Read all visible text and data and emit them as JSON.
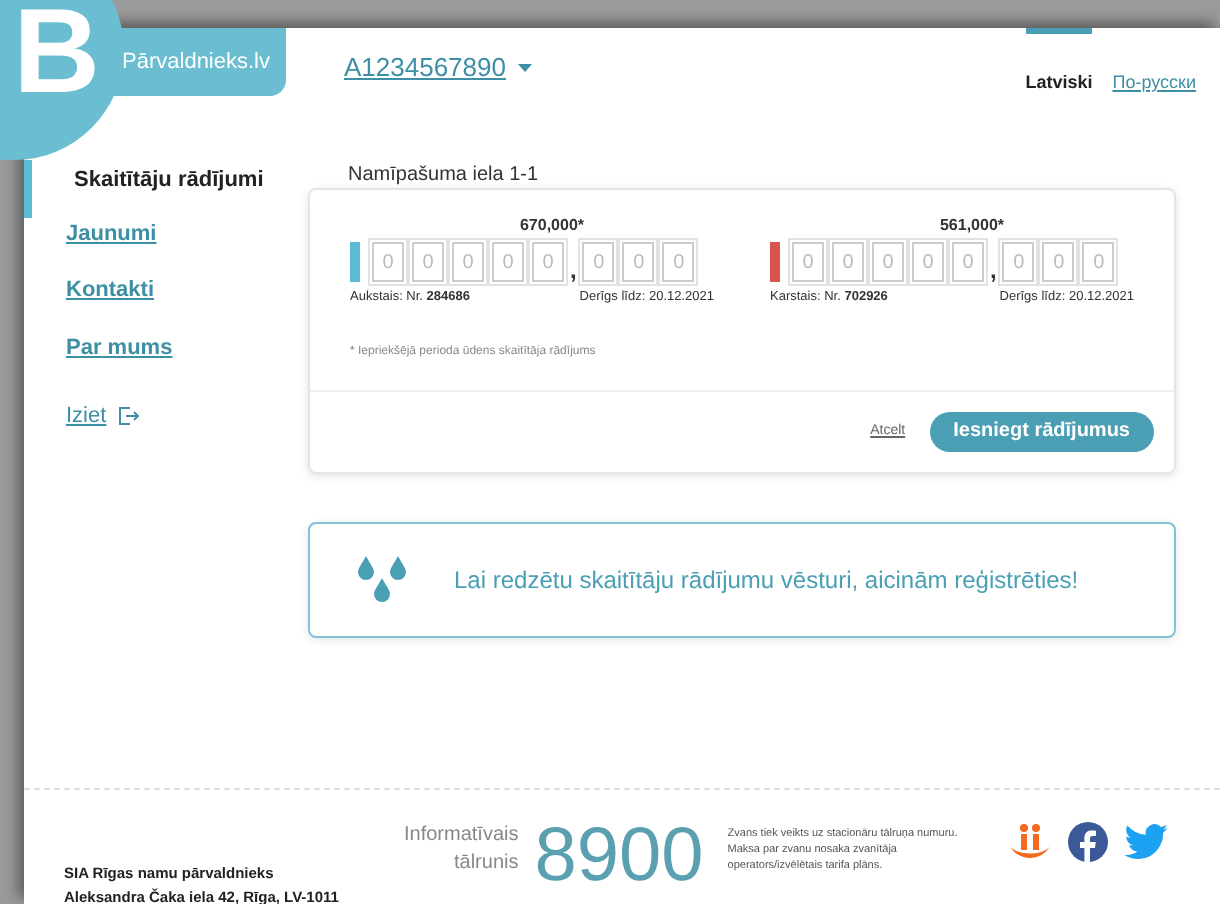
{
  "logo": {
    "letter": "B",
    "site": "Pārvaldnieks.lv"
  },
  "account": {
    "number": "A1234567890"
  },
  "languages": [
    {
      "label": "Latviski",
      "selected": true
    },
    {
      "label": "По-русски",
      "selected": false
    }
  ],
  "sidebar": {
    "items": [
      {
        "label": "Skaitītāju rādījumi",
        "selected": true
      },
      {
        "label": "Jaunumi",
        "selected": false
      },
      {
        "label": "Kontakti",
        "selected": false
      },
      {
        "label": "Par mums",
        "selected": false
      }
    ],
    "logout": "Iziet"
  },
  "address": "Namīpašuma iela 1-1",
  "meters": [
    {
      "previous": "670,000*",
      "color": "#5bbad5",
      "digits": [
        {
          "placeholder": "0"
        },
        {
          "placeholder": "0"
        },
        {
          "placeholder": "0"
        },
        {
          "placeholder": "0"
        },
        {
          "placeholder": "0"
        }
      ],
      "separator": ",",
      "decimals": [
        {
          "placeholder": "0"
        },
        {
          "placeholder": "0"
        },
        {
          "placeholder": "0"
        }
      ],
      "label": "Aukstais: Nr. **284686**",
      "valid": "Derīgs līdz: 20.12.2021"
    },
    {
      "previous": "561,000*",
      "color": "#d9534f",
      "digits": [
        {
          "placeholder": "0"
        },
        {
          "placeholder": "0"
        },
        {
          "placeholder": "0"
        },
        {
          "placeholder": "0"
        },
        {
          "placeholder": "0"
        }
      ],
      "separator": ",",
      "decimals": [
        {
          "placeholder": "0"
        },
        {
          "placeholder": "0"
        },
        {
          "placeholder": "0"
        }
      ],
      "label": "Karstais: Nr. **702926**",
      "valid": "Derīgs līdz: 20.12.2021"
    }
  ],
  "footnote": "* Iepriekšējā perioda ūdens skaitītāja rādījums",
  "actions": {
    "cancel": "Atcelt",
    "submit": "Iesniegt rādījumus"
  },
  "notice": "Lai redzētu skaitītāju rādījumu vēsturi, aicinām reģistrēties!",
  "footer": {
    "company": "SIA Rīgas namu pārvaldnieks",
    "address": "Aleksandra Čaka iela 42, Rīga, LV-1011",
    "phone_label": [
      "Informatīvais",
      "tālrunis"
    ],
    "phone": "8900",
    "note": "Zvans tiek veikts uz stacionāru tālruņa numuru. Maksa par zvanu nosaka zvanītāja operators/izvēlētais tarifa plāns."
  }
}
